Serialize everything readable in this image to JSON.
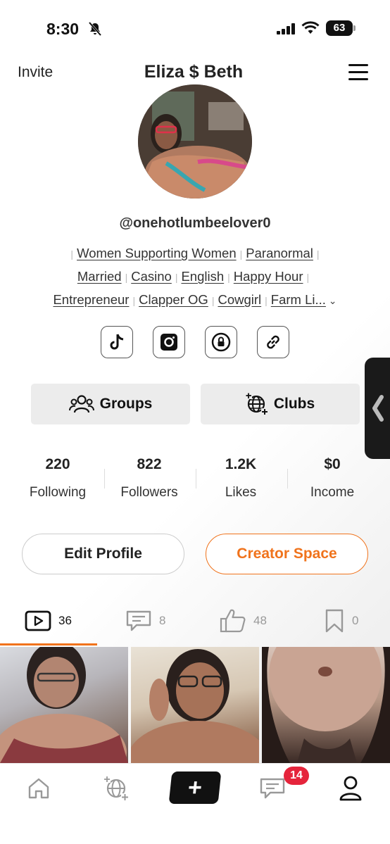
{
  "status_bar": {
    "time": "8:30",
    "battery": "63"
  },
  "header": {
    "invite_label": "Invite",
    "title": "Eliza $ Beth"
  },
  "profile": {
    "handle": "@onehotlumbeelover0",
    "tags_row1": [
      "Women Supporting Women",
      "Paranormal"
    ],
    "tags_row2": [
      "Married",
      "Casino",
      "English",
      "Happy Hour"
    ],
    "tags_row3": [
      "Entrepreneur",
      "Clapper OG",
      "Cowgirl",
      "Farm Li..."
    ]
  },
  "socials": [
    "tiktok-icon",
    "instagram-icon",
    "onlyfans-icon",
    "link-icon"
  ],
  "pills": {
    "groups": "Groups",
    "clubs": "Clubs"
  },
  "stats": [
    {
      "value": "220",
      "label": "Following"
    },
    {
      "value": "822",
      "label": "Followers"
    },
    {
      "value": "1.2K",
      "label": "Likes"
    },
    {
      "value": "$0",
      "label": "Income"
    }
  ],
  "buttons": {
    "edit": "Edit Profile",
    "creator": "Creator Space"
  },
  "tabs": [
    {
      "icon": "video-icon",
      "count": "36"
    },
    {
      "icon": "comment-icon",
      "count": "8"
    },
    {
      "icon": "thumbs-up-icon",
      "count": "48"
    },
    {
      "icon": "bookmark-icon",
      "count": "0"
    }
  ],
  "bottom_nav": {
    "messages_badge": "14"
  },
  "colors": {
    "accent": "#f0731c",
    "badge": "#e5243b"
  }
}
